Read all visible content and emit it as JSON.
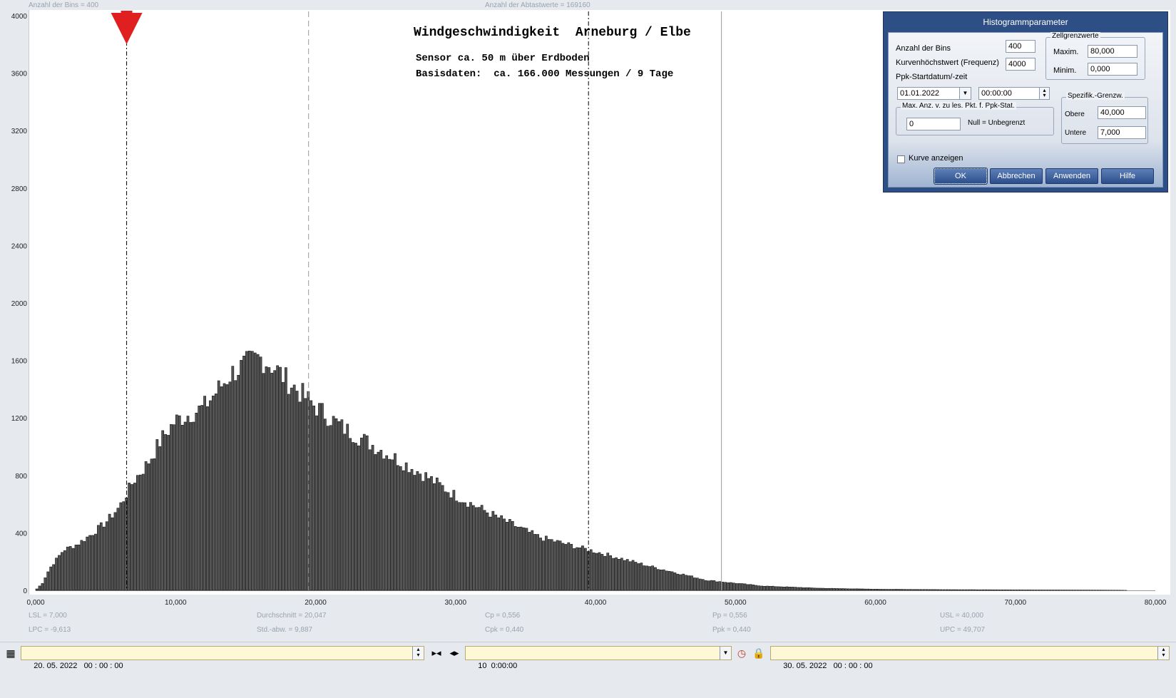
{
  "top_info": {
    "bins": "Anzahl der Bins =   400",
    "samples": "Anzahl der Abtastwerte = 169160"
  },
  "title": "Windgeschwindigkeit  Arneburg / Elbe",
  "subtitle1": "Sensor ca. 50 m über Erdboden",
  "subtitle2": "Basisdaten:  ca. 166.000 Messungen / 9 Tage",
  "stats": {
    "lsl": "LSL = 7,000",
    "lpc": "LPC = -9,613",
    "mean": "Durchschnitt = 20,047",
    "std": "Std.-abw. = 9,887",
    "cp": "Cp = 0,556",
    "cpk": "Cpk = 0,440",
    "pp": "Pp = 0,556",
    "ppk": "Ppk = 0,440",
    "usl": "USL = 40,000",
    "upc": "UPC = 49,707"
  },
  "colors": {
    "bars": "#555555",
    "marker": "#e02020",
    "dialog": "#2e4f86",
    "date_field": "#fff8d6"
  },
  "chart_data": {
    "type": "bar",
    "xlim": [
      0,
      80
    ],
    "ylim": [
      0,
      4000
    ],
    "bin_width": 0.2,
    "x_ticks": [
      "0,000",
      "10,000",
      "20,000",
      "30,000",
      "40,000",
      "50,000",
      "60,000",
      "70,000",
      "80,000"
    ],
    "y_ticks": [
      "0",
      "400",
      "800",
      "1200",
      "1600",
      "2000",
      "2400",
      "2800",
      "3200",
      "3600",
      "4000"
    ],
    "profile_x": [
      0,
      0.5,
      1,
      2,
      3,
      4,
      5,
      6,
      7,
      8,
      9,
      10,
      12,
      14,
      15,
      16,
      17,
      18,
      20,
      22,
      25,
      28,
      30,
      33,
      36,
      40,
      44,
      48,
      52,
      56,
      60,
      65,
      70,
      75,
      77.5,
      78
    ],
    "profile_y": [
      0,
      50,
      150,
      280,
      320,
      390,
      470,
      580,
      760,
      880,
      1050,
      1180,
      1270,
      1510,
      1570,
      1620,
      1560,
      1460,
      1280,
      1130,
      960,
      790,
      660,
      510,
      370,
      270,
      165,
      70,
      30,
      15,
      8,
      5,
      3,
      2,
      1,
      0
    ],
    "lines": [
      {
        "x": 6.5,
        "style": "dash-dot",
        "label": "LSL"
      },
      {
        "x": 19.5,
        "style": "dashed",
        "label": "Durchschnitt"
      },
      {
        "x": 39.5,
        "style": "dash-dot",
        "label": "USL"
      },
      {
        "x": 49.0,
        "style": "solid",
        "label": "UPC"
      }
    ],
    "marker_x": 6.5
  },
  "dialog": {
    "title": "Histogrammparameter",
    "bins_label": "Anzahl der Bins",
    "bins_value": "400",
    "curve_max_label": "Kurvenhöchstwert (Frequenz)",
    "curve_max_value": "4000",
    "ppk_label": "Ppk-Startdatum/-zeit",
    "ppk_date": "01.01.2022",
    "ppk_time": "00:00:00",
    "cell_limits_title": "Zellgrenzwerte",
    "max_label": "Maxim.",
    "max_value": "80,000",
    "min_label": "Minim.",
    "min_value": "0,000",
    "max_points_title": "Max. Anz. v. zu les. Pkt. f. Ppk-Stat.",
    "max_points_value": "0",
    "null_hint": "Null = Unbegrenzt",
    "spec_title": "Spezifik.-Grenzw.",
    "upper_label": "Obere",
    "upper_value": "40,000",
    "lower_label": "Untere",
    "lower_value": "7,000",
    "show_curve_label": "Kurve anzeigen",
    "show_curve_checked": false,
    "ok": "OK",
    "cancel": "Abbrechen",
    "apply": "Anwenden",
    "help": "Hilfe"
  },
  "bottom": {
    "start": "20. 05. 2022   00 : 00 : 00",
    "interval": "10  0:00:00",
    "end": "30. 05. 2022   00 : 00 : 00"
  }
}
